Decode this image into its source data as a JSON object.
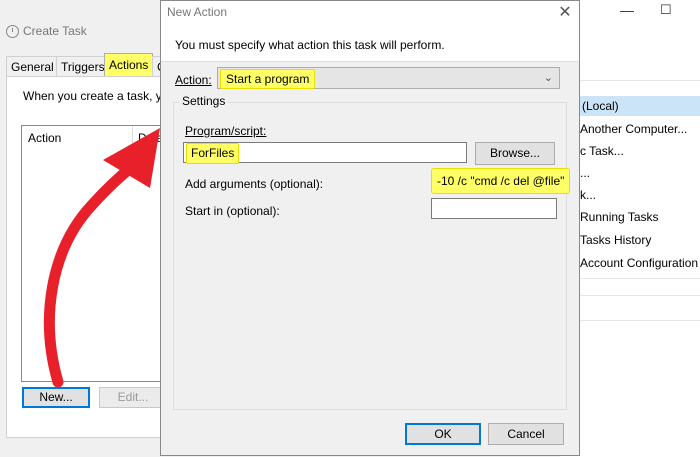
{
  "background_window": {
    "titlebar": {
      "minimize_glyph": "—",
      "maximize_glyph": "☐"
    },
    "actions": [
      {
        "label": "(Local)",
        "selected": true
      },
      {
        "label": "Another Computer..."
      },
      {
        "label": "c Task..."
      },
      {
        "label": "..."
      },
      {
        "label": "k..."
      },
      {
        "label": "Running Tasks"
      },
      {
        "label": "Tasks History"
      },
      {
        "label": "Account Configuration"
      }
    ]
  },
  "create_task": {
    "title": "Create Task",
    "tabs": [
      {
        "label": "General"
      },
      {
        "label": "Triggers"
      },
      {
        "label": "Actions",
        "active": true
      },
      {
        "label": "C"
      }
    ],
    "description": "When you create a task, you",
    "table_headers": [
      "Action",
      "Deta"
    ],
    "buttons": {
      "new": "New...",
      "edit": "Edit..."
    }
  },
  "new_action": {
    "title": "New Action",
    "close_glyph": "✕",
    "message": "You must specify what action this task will perform.",
    "action_label": "Action:",
    "action_value": "Start a program",
    "settings_title": "Settings",
    "program_label": "Program/script:",
    "program_value": "ForFiles",
    "browse_label": "Browse...",
    "args_label": "Add arguments (optional):",
    "args_value": "-10 /c \"cmd /c del @file\"",
    "start_label": "Start in (optional):",
    "start_value": "",
    "ok_label": "OK",
    "cancel_label": "Cancel"
  },
  "colors": {
    "highlight": "#ffff66",
    "arrow": "#e8202a",
    "selection": "#cce4f7",
    "primary_border": "#0078d7"
  }
}
